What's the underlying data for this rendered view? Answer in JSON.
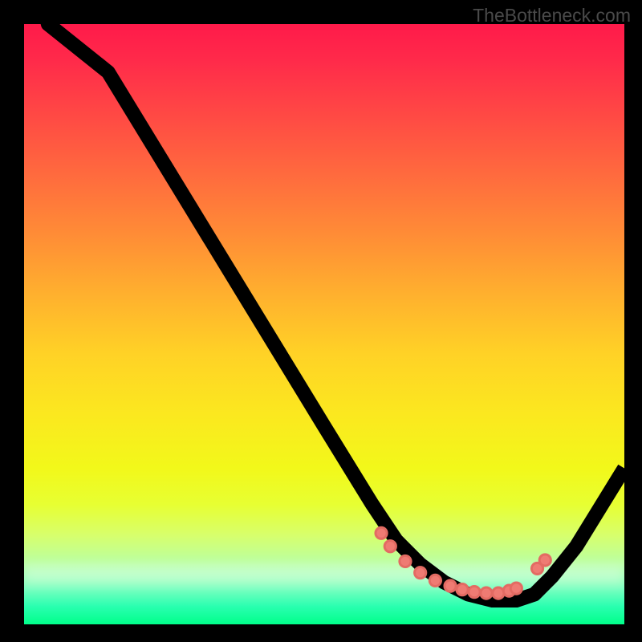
{
  "watermark": "TheBottleneck.com",
  "colors": {
    "black": "#000000",
    "curve": "#000000",
    "dot": "#ef7b73",
    "gradient_top": "#ff1a4a",
    "gradient_bottom": "#00ff8a"
  },
  "chart_data": {
    "type": "line",
    "title": "",
    "xlabel": "",
    "ylabel": "",
    "xlim": [
      0,
      100
    ],
    "ylim": [
      0,
      100
    ],
    "series": [
      {
        "name": "curve",
        "x": [
          0,
          4,
          14,
          50,
          58,
          62,
          66,
          70,
          74,
          78,
          82,
          85,
          88,
          92,
          100
        ],
        "y": [
          115,
          100,
          92,
          33,
          20,
          14,
          10,
          7,
          5,
          4,
          4,
          5,
          8,
          13,
          26
        ]
      }
    ],
    "markers": {
      "name": "dots",
      "x": [
        59.5,
        61,
        63.5,
        66,
        68.5,
        71,
        73,
        75,
        77,
        79,
        80.8,
        82,
        85.5,
        86.8
      ],
      "y": [
        15.2,
        13,
        10.5,
        8.6,
        7.3,
        6.4,
        5.8,
        5.4,
        5.2,
        5.2,
        5.6,
        6.0,
        9.3,
        10.7
      ]
    }
  }
}
